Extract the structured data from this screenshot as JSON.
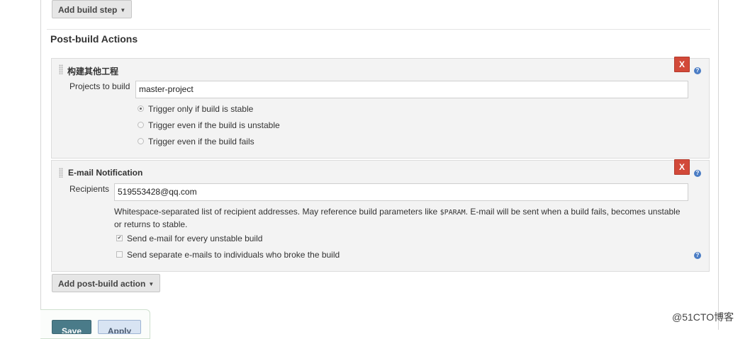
{
  "build": {
    "add_build_step_label": "Add build step"
  },
  "post_build": {
    "title": "Post-build Actions",
    "build_other_projects": {
      "title": "构建其他工程",
      "delete_label": "X",
      "help_label": "?",
      "projects_label": "Projects to build",
      "projects_value": "master-project",
      "options": [
        {
          "label": "Trigger only if build is stable",
          "selected": true
        },
        {
          "label": "Trigger even if the build is unstable",
          "selected": false
        },
        {
          "label": "Trigger even if the build fails",
          "selected": false
        }
      ]
    },
    "email_notification": {
      "title": "E-mail Notification",
      "delete_label": "X",
      "help_label": "?",
      "recipients_label": "Recipients",
      "recipients_value": "519553428@qq.com",
      "description_part1": "Whitespace-separated list of recipient addresses. May reference build parameters like ",
      "description_code": "$PARAM",
      "description_part2": ". E-mail will be sent when a build fails, becomes unstable or returns to stable.",
      "checkboxes": [
        {
          "label": "Send e-mail for every unstable build",
          "checked": true
        },
        {
          "label": "Send separate e-mails to individuals who broke the build",
          "checked": false
        }
      ]
    },
    "add_post_build_action_label": "Add post-build action"
  },
  "footer": {
    "save_label": "Save",
    "apply_label": "Apply"
  },
  "watermark": "@51CTO博客"
}
